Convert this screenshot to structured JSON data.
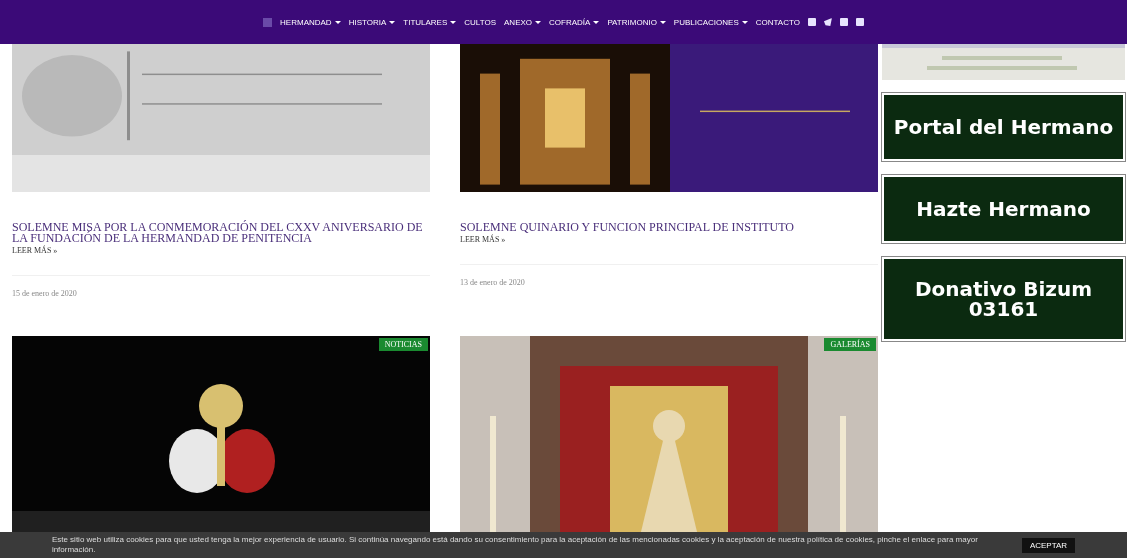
{
  "nav": {
    "items": [
      {
        "label": "HERMANDAD",
        "dropdown": true
      },
      {
        "label": "HISTORIA",
        "dropdown": true
      },
      {
        "label": "TITULARES",
        "dropdown": true
      },
      {
        "label": "CULTOS",
        "dropdown": false
      },
      {
        "label": "ANEXO",
        "dropdown": true
      },
      {
        "label": "COFRADÍA",
        "dropdown": true
      },
      {
        "label": "PATRIMONIO",
        "dropdown": true
      },
      {
        "label": "PUBLICACIONES",
        "dropdown": true
      },
      {
        "label": "CONTACTO",
        "dropdown": false
      }
    ]
  },
  "posts": [
    {
      "title": "SOLEMNE MISA POR LA CONMEMORACIÓN DEL CXXV ANIVERSARIO DE LA FUNDACIÓN DE LA HERMANDAD DE PENITENCIA",
      "more": "LEER MÁS »",
      "date": "15 de enero de 2020"
    },
    {
      "title": "SOLEMNE QUINARIO Y FUNCION PRINCIPAL DE INSTITUTO",
      "more": "LEER MÁS »",
      "date": "13 de enero de 2020"
    },
    {
      "badge": "NOTICIAS"
    },
    {
      "badge": "GALERÍAS"
    }
  ],
  "sidebar": {
    "buttons": [
      {
        "label": "Portal del Hermano"
      },
      {
        "label": "Hazte Hermano"
      },
      {
        "label": "Donativo Bizum 03161"
      }
    ]
  },
  "cookie_bar": {
    "text": "Este sitio web utiliza cookies para que usted tenga la mejor experiencia de usuario. Si continúa navegando está dando su consentimiento para la aceptación de las mencionadas cookies y la aceptación de nuestra política de cookies, pinche el enlace para mayor información.",
    "button": "ACEPTAR"
  }
}
